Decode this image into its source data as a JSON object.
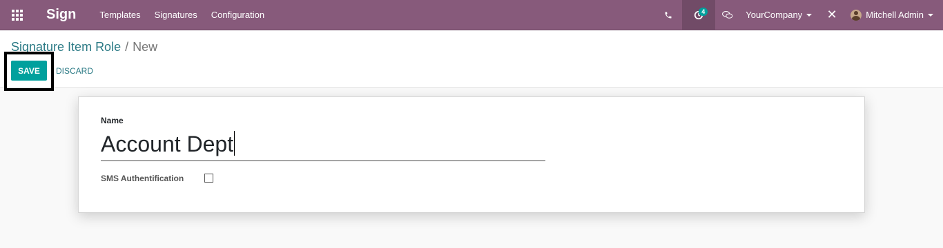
{
  "navbar": {
    "app_name": "Sign",
    "menu": [
      "Templates",
      "Signatures",
      "Configuration"
    ],
    "activity_count": "4",
    "company": "YourCompany",
    "user": "Mitchell Admin",
    "color": "#875a7b",
    "icons": [
      "apps-grid-icon",
      "phone-icon",
      "activity-clock-icon",
      "chat-bubbles-icon",
      "debug-tools-icon",
      "user-avatar"
    ]
  },
  "breadcrumb": {
    "parent": "Signature Item Role",
    "separator": "/",
    "current": "New"
  },
  "buttons": {
    "save": "SAVE",
    "discard": "DISCARD",
    "save_color": "#00a09d"
  },
  "form": {
    "name_label": "Name",
    "name_value": "Account Dept",
    "sms_label": "SMS Authentification",
    "sms_checked": false
  }
}
